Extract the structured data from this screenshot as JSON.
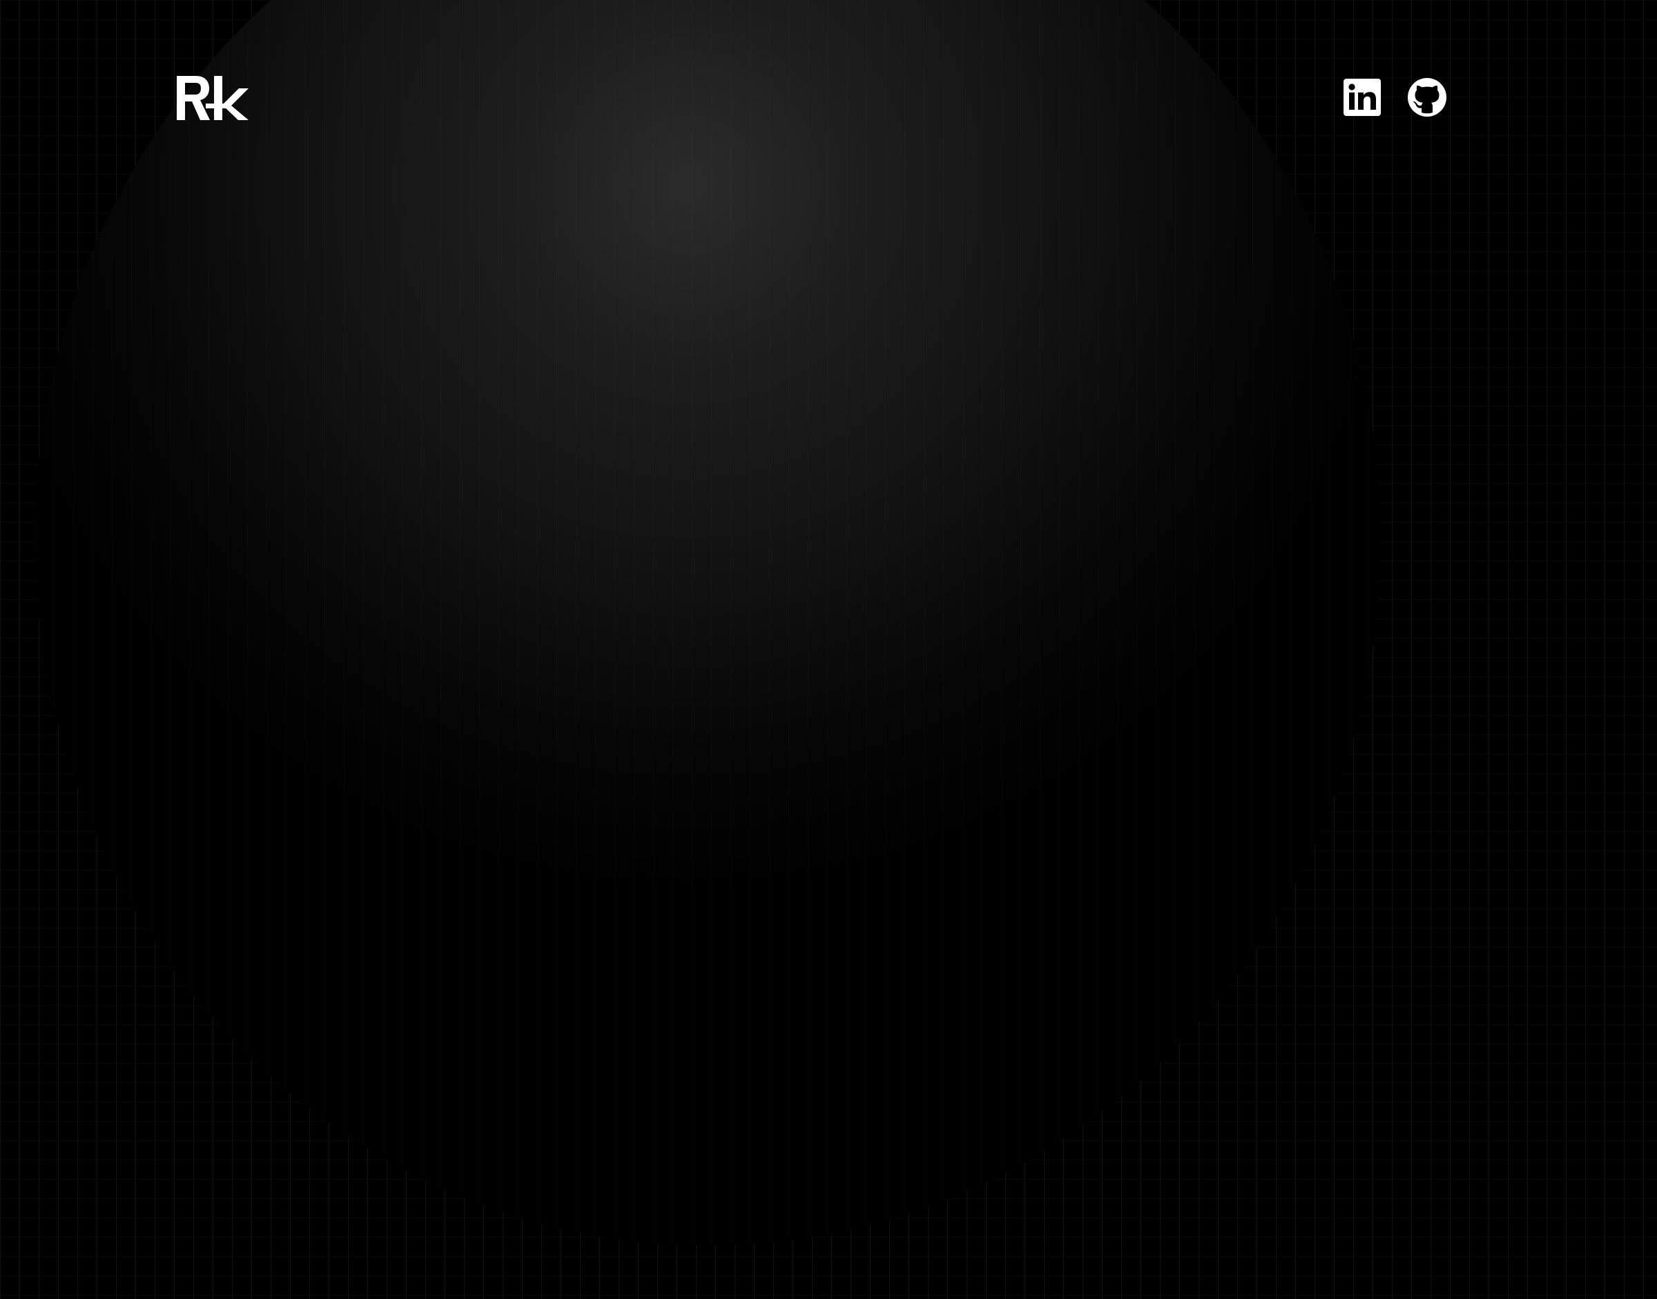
{
  "header": {
    "logo": {
      "text": "Rk",
      "icon": "rk-logo"
    },
    "social": [
      {
        "name": "LinkedIn",
        "icon": "linkedin-icon"
      },
      {
        "name": "GitHub",
        "icon": "github-icon"
      }
    ]
  },
  "theme": {
    "background": "#000000",
    "foreground": "#ffffff",
    "grid": "#1a1a1a"
  }
}
